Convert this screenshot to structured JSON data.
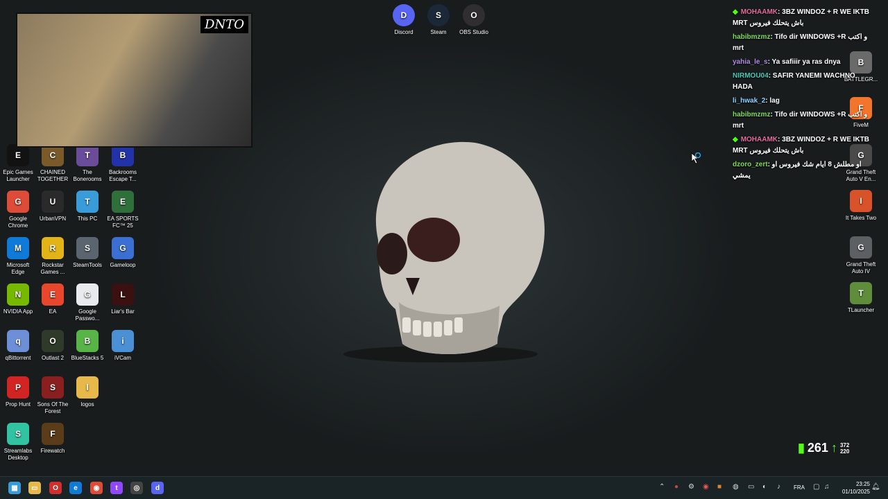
{
  "desktop": {
    "top_icons": [
      {
        "label": "Discord",
        "icon": "discord-icon",
        "color": "#5865f2"
      },
      {
        "label": "Steam",
        "icon": "steam-icon",
        "color": "#1b2838"
      },
      {
        "label": "OBS Studio",
        "icon": "obs-icon",
        "color": "#302e31"
      }
    ],
    "left_icons": [
      {
        "label": "Epic Games Launcher",
        "icon": "epic-icon",
        "color": "#121212"
      },
      {
        "label": "CHAINED TOGETHER",
        "icon": "chained-icon",
        "color": "#7b5a2a"
      },
      {
        "label": "The Bonerooms",
        "icon": "bonerooms-icon",
        "color": "#6b4c9a"
      },
      {
        "label": "Backrooms Escape T...",
        "icon": "backrooms-icon",
        "color": "#2233aa"
      },
      {
        "label": "Google Chrome",
        "icon": "chrome-icon",
        "color": "#dd4b39"
      },
      {
        "label": "UrbanVPN",
        "icon": "urbanvpn-icon",
        "color": "#2a2a2a"
      },
      {
        "label": "This PC",
        "icon": "this-pc-icon",
        "color": "#3a9bd9"
      },
      {
        "label": "EA SPORTS FC™ 25",
        "icon": "ea-fc-icon",
        "color": "#2f6f3a"
      },
      {
        "label": "Microsoft Edge",
        "icon": "edge-icon",
        "color": "#0f7ad8"
      },
      {
        "label": "Rockstar Games ...",
        "icon": "rockstar-icon",
        "color": "#e2b417"
      },
      {
        "label": "SteamTools",
        "icon": "steamtools-icon",
        "color": "#5a6570"
      },
      {
        "label": "Gameloop",
        "icon": "gameloop-icon",
        "color": "#3b6fd1"
      },
      {
        "label": "NVIDIA App",
        "icon": "nvidia-icon",
        "color": "#76b900"
      },
      {
        "label": "EA",
        "icon": "ea-icon",
        "color": "#e8472d"
      },
      {
        "label": "Google Passwo...",
        "icon": "google-password-icon",
        "color": "#e8eaed"
      },
      {
        "label": "Liar's Bar",
        "icon": "liars-bar-icon",
        "color": "#3a1010"
      },
      {
        "label": "qBittorrent",
        "icon": "qbittorrent-icon",
        "color": "#6d8fd8"
      },
      {
        "label": "Outlast 2",
        "icon": "outlast-icon",
        "color": "#2f3a2a"
      },
      {
        "label": "BlueStacks 5",
        "icon": "bluestacks-icon",
        "color": "#58b447"
      },
      {
        "label": "iVCam",
        "icon": "ivcam-icon",
        "color": "#4b8fd4"
      },
      {
        "label": "Prop Hunt",
        "icon": "prop-hunt-icon",
        "color": "#d32424"
      },
      {
        "label": "Sons Of The Forest",
        "icon": "sons-forest-icon",
        "color": "#8a1f1f"
      },
      {
        "label": "logos",
        "icon": "folder-icon",
        "color": "#e6b94a"
      },
      {
        "label": "Streamlabs Desktop",
        "icon": "streamlabs-icon",
        "color": "#31c3a2"
      },
      {
        "label": "Firewatch",
        "icon": "firewatch-icon",
        "color": "#5a3b1a"
      }
    ],
    "right_icons": [
      {
        "label": "BATTLEGR...",
        "icon": "pubg-icon",
        "color": "#6a6a6a"
      },
      {
        "label": "FiveM",
        "icon": "fivem-icon",
        "color": "#f2752b"
      },
      {
        "label": "Grand Theft Auto V En...",
        "icon": "gta5-icon",
        "color": "#4a4a4a"
      },
      {
        "label": "It Takes Two",
        "icon": "it-takes-two-icon",
        "color": "#d8532a"
      },
      {
        "label": "Grand Theft Auto IV",
        "icon": "gta4-icon",
        "color": "#5c6062"
      },
      {
        "label": "TLauncher",
        "icon": "tlauncher-icon",
        "color": "#5f8d3b"
      }
    ]
  },
  "webcam": {
    "logo": "DNTO"
  },
  "chat": [
    {
      "user": "MOHAAMK",
      "user_color": "#e36b9b",
      "badge": "◆",
      "text": ": 3BZ WINDOZ + R WE IKTB MRT باش يتحلك فيروس"
    },
    {
      "user": "habibmzmz",
      "user_color": "#7ed957",
      "text": ": Tifo dir WINDOWS +R و اكتب mrt"
    },
    {
      "user": "yahia_le_s",
      "user_color": "#b28be0",
      "text": ": Ya safiiir ya ras dnya"
    },
    {
      "user": "NIRMOU04",
      "user_color": "#4cc7b6",
      "text": ": SAFIR YANEMI WACHNO HADA"
    },
    {
      "user": "li_hwak_2",
      "user_color": "#8fd0ff",
      "text": ": lag"
    },
    {
      "user": "habibmzmz",
      "user_color": "#7ed957",
      "text": ": Tifo dir WINDOWS +R و اكتب mrt"
    },
    {
      "user": "MOHAAMK",
      "user_color": "#e36b9b",
      "badge": "◆",
      "text": ": 3BZ WINDOZ + R WE IKTB MRT باش يتحلك فيروس"
    },
    {
      "user": "dzoro_zert",
      "user_color": "#7ed957",
      "text": ": او مطلش 8 ايام شك فيروس او يمشي"
    }
  ],
  "stats": {
    "kick_count": "261",
    "small_top": "372",
    "small_bottom": "220"
  },
  "taskbar": {
    "icons": [
      {
        "name": "start-icon",
        "color": "#3a9bd9",
        "glyph": "▦"
      },
      {
        "name": "file-explorer-icon",
        "color": "#e6b94a",
        "glyph": "▭"
      },
      {
        "name": "opera-icon",
        "color": "#d42d2d",
        "glyph": "O"
      },
      {
        "name": "edge-taskbar-icon",
        "color": "#0f7ad8",
        "glyph": "e"
      },
      {
        "name": "chrome-taskbar-icon",
        "color": "#dd4b39",
        "glyph": "◉"
      },
      {
        "name": "twitch-icon",
        "color": "#9146ff",
        "glyph": "t"
      },
      {
        "name": "obs-taskbar-icon",
        "color": "#444",
        "glyph": "◎"
      },
      {
        "name": "discord-taskbar-icon",
        "color": "#5865f2",
        "glyph": "d"
      }
    ],
    "language": "FRA",
    "time": "23:25",
    "date": "01/10/2025"
  }
}
